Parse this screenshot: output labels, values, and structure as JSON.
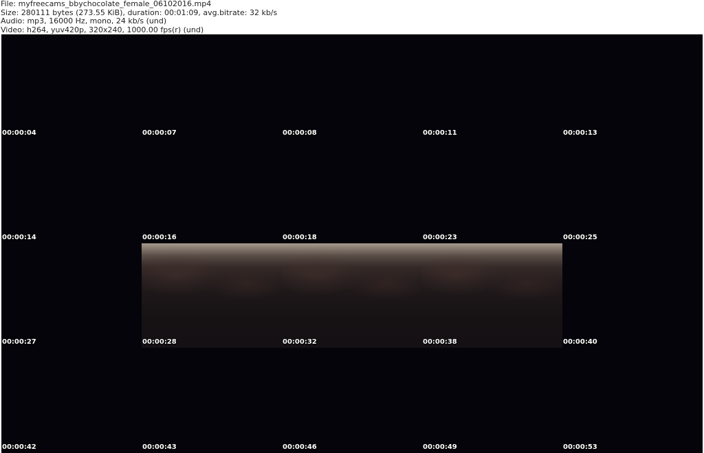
{
  "header": {
    "file_line": "File: myfreecams_bbychocolate_female_06102016.mp4",
    "size_line": "Size: 280111 bytes (273.55 KiB), duration: 00:01:09, avg.bitrate: 32 kb/s",
    "audio_line": "Audio: mp3, 16000 Hz, mono, 24 kb/s (und)",
    "video_line": "Video: h264, yuv420p, 320x240, 1000.00 fps(r) (und)"
  },
  "thumbnails": [
    {
      "timestamp": "00:00:04",
      "lit": false
    },
    {
      "timestamp": "00:00:07",
      "lit": false
    },
    {
      "timestamp": "00:00:08",
      "lit": false
    },
    {
      "timestamp": "00:00:11",
      "lit": false
    },
    {
      "timestamp": "00:00:13",
      "lit": false
    },
    {
      "timestamp": "00:00:14",
      "lit": false
    },
    {
      "timestamp": "00:00:16",
      "lit": false
    },
    {
      "timestamp": "00:00:18",
      "lit": false
    },
    {
      "timestamp": "00:00:23",
      "lit": false
    },
    {
      "timestamp": "00:00:25",
      "lit": false
    },
    {
      "timestamp": "00:00:27",
      "lit": false
    },
    {
      "timestamp": "00:00:28",
      "lit": true
    },
    {
      "timestamp": "00:00:32",
      "lit": true
    },
    {
      "timestamp": "00:00:38",
      "lit": true
    },
    {
      "timestamp": "00:00:40",
      "lit": false
    },
    {
      "timestamp": "00:00:42",
      "lit": false
    },
    {
      "timestamp": "00:00:43",
      "lit": false
    },
    {
      "timestamp": "00:00:46",
      "lit": false
    },
    {
      "timestamp": "00:00:49",
      "lit": false
    },
    {
      "timestamp": "00:00:53",
      "lit": false
    }
  ]
}
